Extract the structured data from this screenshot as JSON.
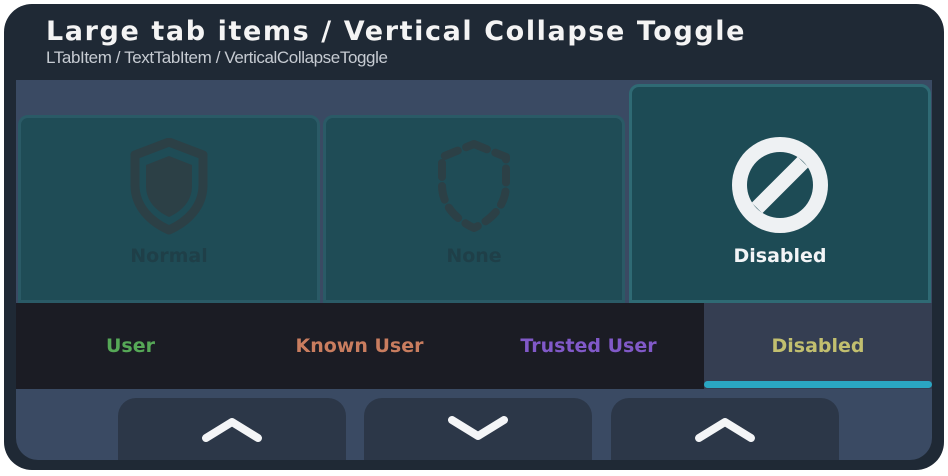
{
  "header": {
    "title": "Large tab items / Vertical Collapse Toggle",
    "subtitle": "LTabItem / TextTabItem / VerticalCollapseToggle"
  },
  "tabs": [
    {
      "label": "Normal",
      "icon": "shield-icon",
      "state": "inactive"
    },
    {
      "label": "None",
      "icon": "dashed-shield-icon",
      "state": "inactive"
    },
    {
      "label": "Disabled",
      "icon": "prohibited-icon",
      "state": "selected"
    }
  ],
  "text_tabs": [
    {
      "label": "User",
      "color": "#56a857"
    },
    {
      "label": "Known User",
      "color": "#c97d5f"
    },
    {
      "label": "Trusted User",
      "color": "#8159c8"
    },
    {
      "label": "Disabled",
      "color": "#c2bf6f",
      "selected": true
    }
  ],
  "collapse_toggles": [
    {
      "icon": "chevron-up-icon"
    },
    {
      "icon": "chevron-down-icon"
    },
    {
      "icon": "chevron-up-icon"
    }
  ],
  "colors": {
    "frame": "#1f2935",
    "content": "#3a4a63",
    "tab": "#1f4c56",
    "accent": "#2aa6c2"
  }
}
